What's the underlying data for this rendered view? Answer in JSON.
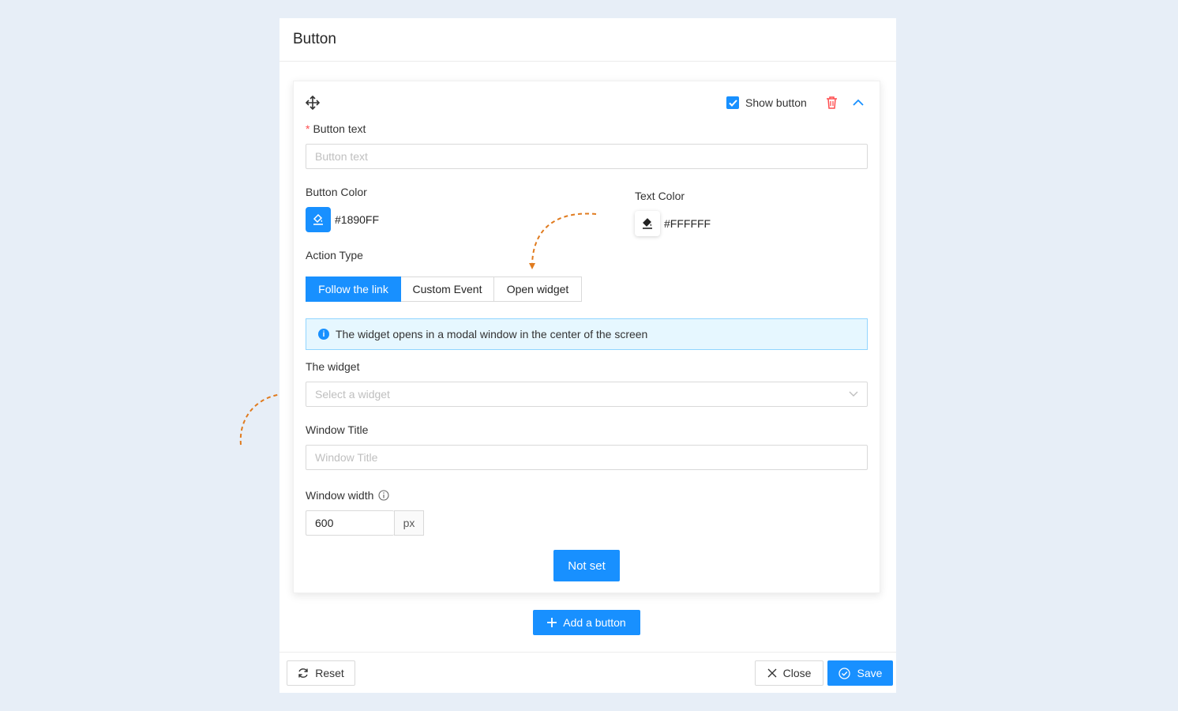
{
  "panel": {
    "title": "Button"
  },
  "card": {
    "show_button_label": "Show button",
    "show_button_checked": true,
    "button_text": {
      "label": "Button text",
      "placeholder": "Button text"
    },
    "button_color": {
      "label": "Button Color",
      "value": "#1890FF"
    },
    "text_color": {
      "label": "Text Color",
      "value": "#FFFFFF"
    },
    "action_type": {
      "label": "Action Type",
      "options": [
        "Follow the link",
        "Custom Event",
        "Open widget"
      ],
      "selected": "Follow the link"
    },
    "info_message": "The widget opens in a modal window in the center of the screen",
    "widget": {
      "label": "The widget",
      "placeholder": "Select a widget"
    },
    "window_title": {
      "label": "Window Title",
      "placeholder": "Window Title"
    },
    "window_width": {
      "label": "Window width",
      "value": "600",
      "unit": "px"
    },
    "preview_button_label": "Not set"
  },
  "add_button_label": "Add a button",
  "footer": {
    "reset_label": "Reset",
    "close_label": "Close",
    "save_label": "Save"
  },
  "colors": {
    "accent": "#1890FF",
    "danger": "#FF4D4F",
    "annotation_arrow": "#E07B1F",
    "background": "#E7EEF7"
  }
}
